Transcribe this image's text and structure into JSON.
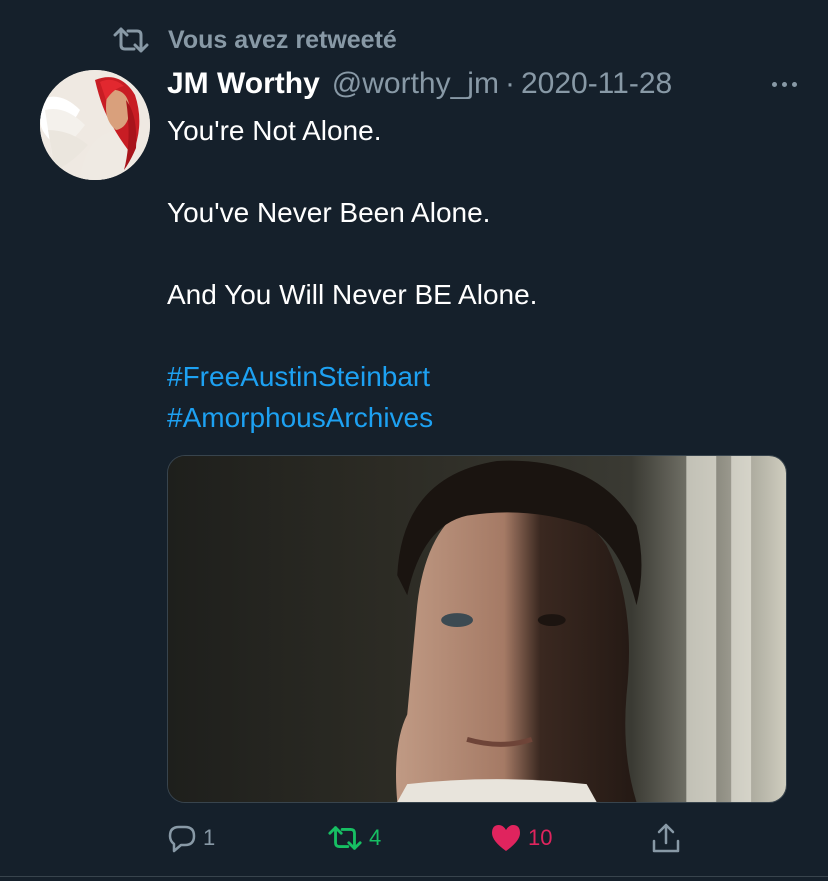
{
  "retweet_context": {
    "icon": "retweet-icon",
    "label": "Vous avez retweeté"
  },
  "tweet": {
    "author": {
      "display_name": "JM Worthy",
      "handle": "@worthy_jm",
      "avatar": "avatar-red-haired-angel"
    },
    "separator": "·",
    "date": "2020-11-28",
    "more_icon": "more-icon",
    "text_lines": [
      "You're Not Alone.",
      "You've Never Been Alone.",
      "And You Will Never BE Alone."
    ],
    "hashtags": [
      "#FreeAustinSteinbart",
      "#AmorphousArchives"
    ],
    "media": "video-still-man-portrait"
  },
  "actions": {
    "reply": {
      "icon": "reply-icon",
      "count": "1"
    },
    "retweet": {
      "icon": "retweet-icon",
      "count": "4",
      "active": true
    },
    "like": {
      "icon": "heart-icon",
      "count": "10",
      "active": true
    },
    "share": {
      "icon": "share-icon"
    }
  },
  "colors": {
    "background": "#15202b",
    "secondary_text": "#8899a6",
    "link": "#1da1f2",
    "retweet_active": "#17bf63",
    "like_active": "#e0245e",
    "border": "#38444d"
  }
}
